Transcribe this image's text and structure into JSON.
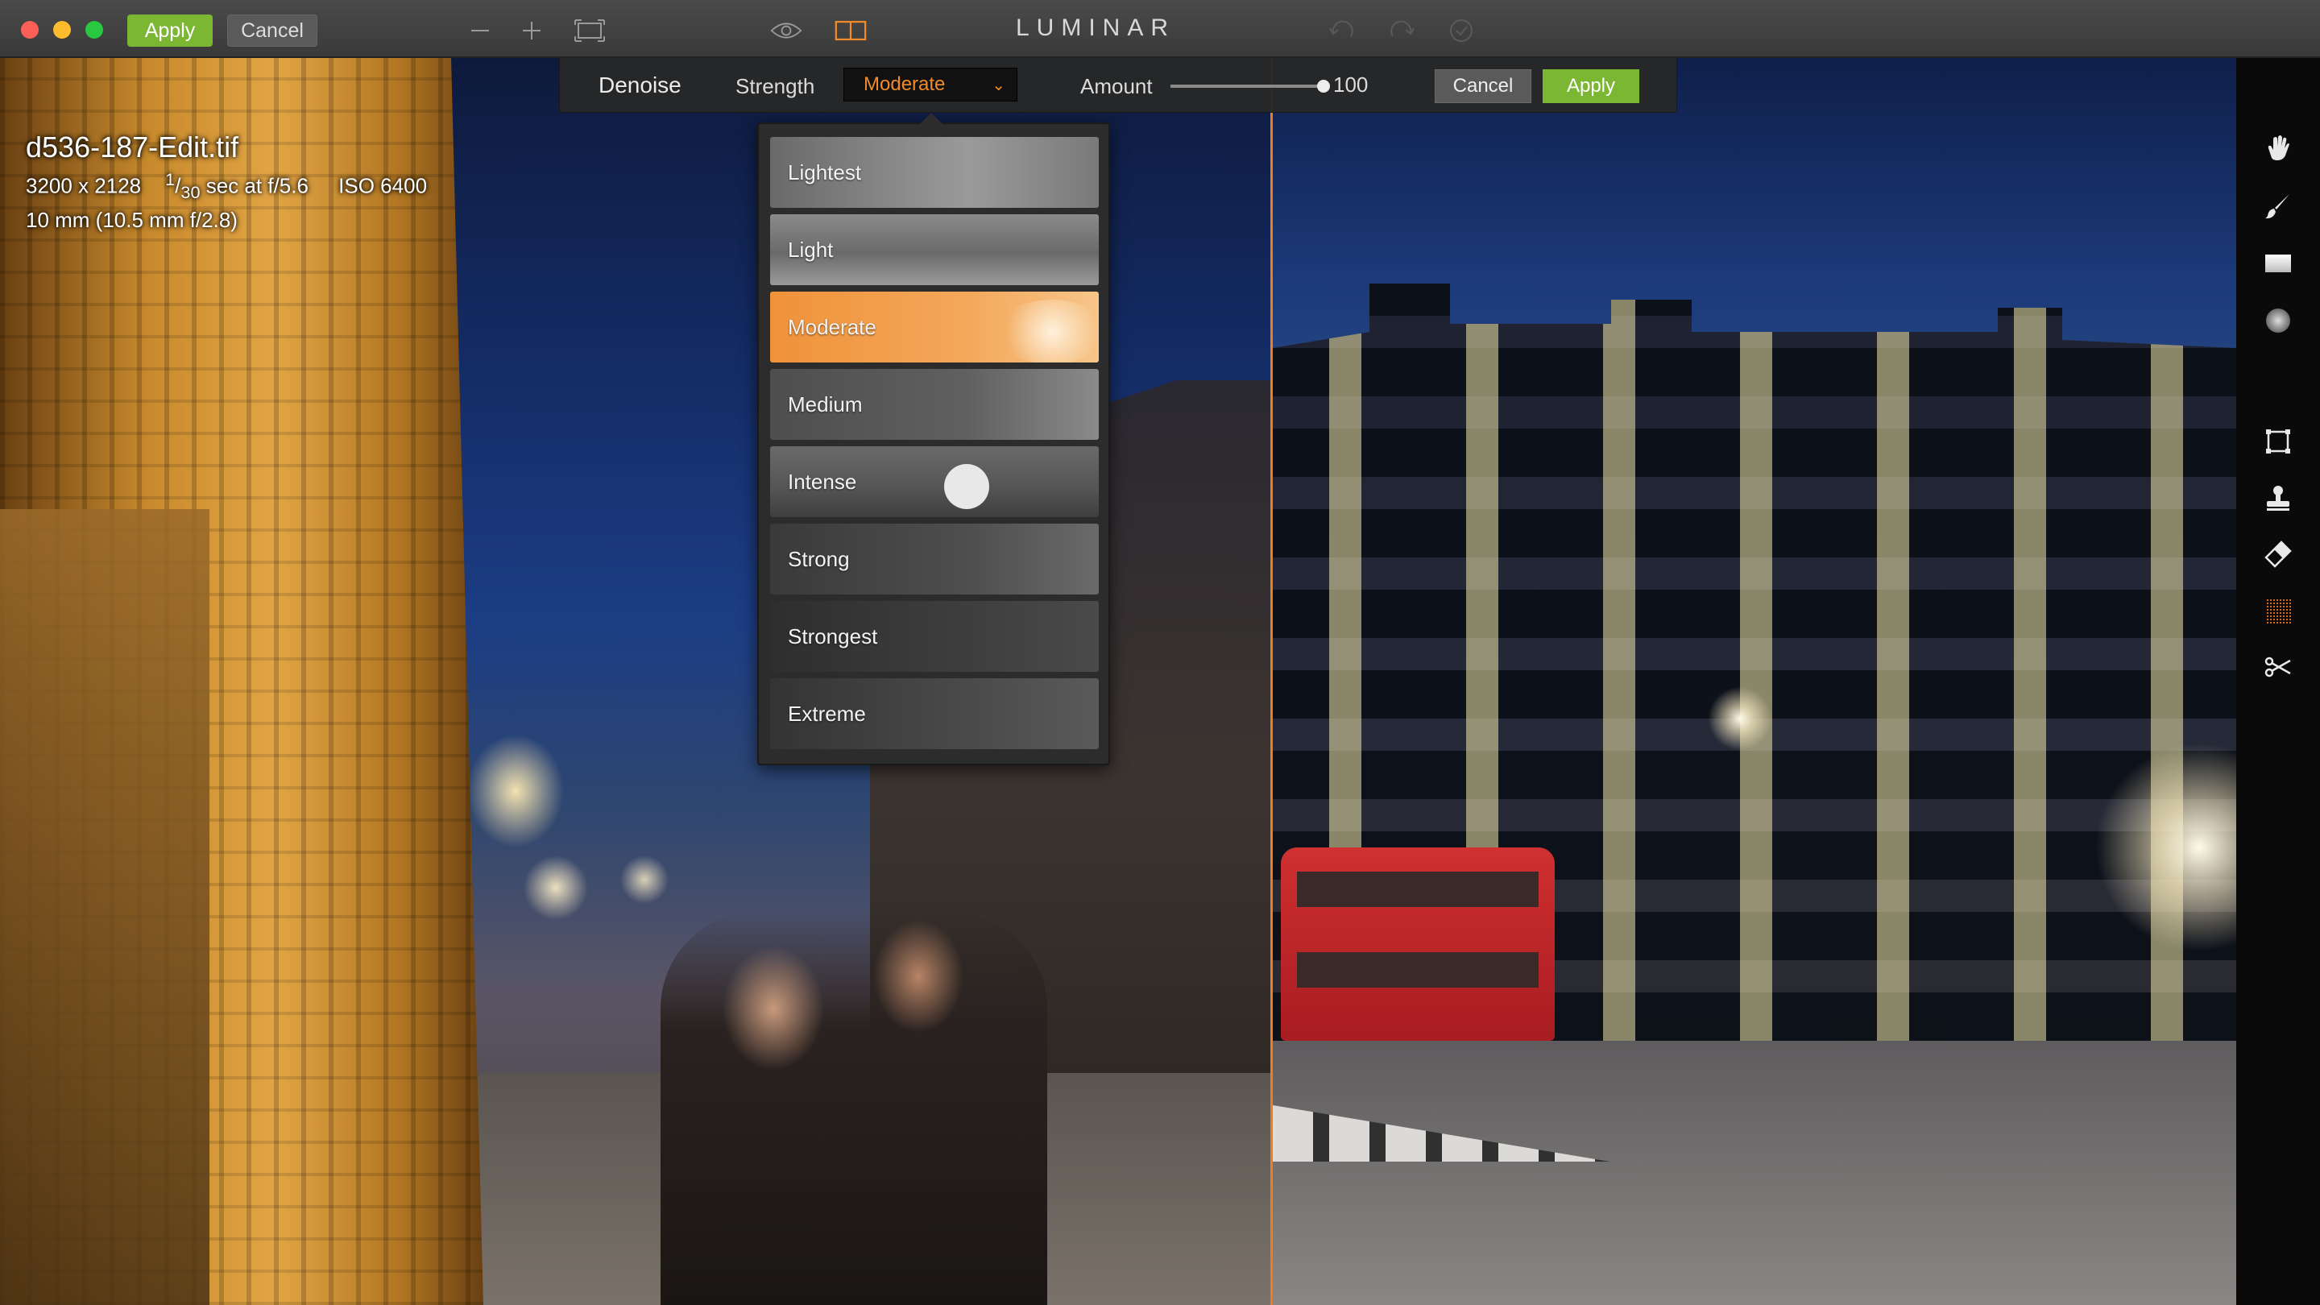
{
  "window": {
    "app_title": "LUMINAR",
    "apply_label": "Apply",
    "cancel_label": "Cancel"
  },
  "toolbar_icons": [
    "zoom-out-icon",
    "zoom-in-icon",
    "fit-screen-icon",
    "eye-preview-icon",
    "split-view-icon",
    "undo-icon",
    "redo-icon",
    "history-icon"
  ],
  "image_info": {
    "filename": "d536-187-Edit.tif",
    "dimensions": "3200 x 2128",
    "shutter_num": "1",
    "shutter_den": "30",
    "exposure_rest": "sec at f/5.6",
    "iso": "ISO 6400",
    "lens": "10 mm (10.5 mm f/2.8)"
  },
  "denoise": {
    "title": "Denoise",
    "strength_label": "Strength",
    "selected_preset": "Moderate",
    "amount_label": "Amount",
    "amount_value": "100",
    "amount_fraction": 1.0,
    "cancel_label": "Cancel",
    "apply_label": "Apply",
    "presets": [
      "Lightest",
      "Light",
      "Moderate",
      "Medium",
      "Intense",
      "Strong",
      "Strongest",
      "Extreme"
    ]
  },
  "tools": [
    "pan-hand-icon",
    "brush-icon",
    "gradient-mask-icon",
    "radial-mask-icon",
    "crop-icon",
    "clone-stamp-icon",
    "eraser-icon",
    "noise-texture-icon",
    "cut-scissors-icon"
  ],
  "colors": {
    "accent": "#f08a2a",
    "apply_green": "#7cb733",
    "split_line": "#f07c1e"
  }
}
